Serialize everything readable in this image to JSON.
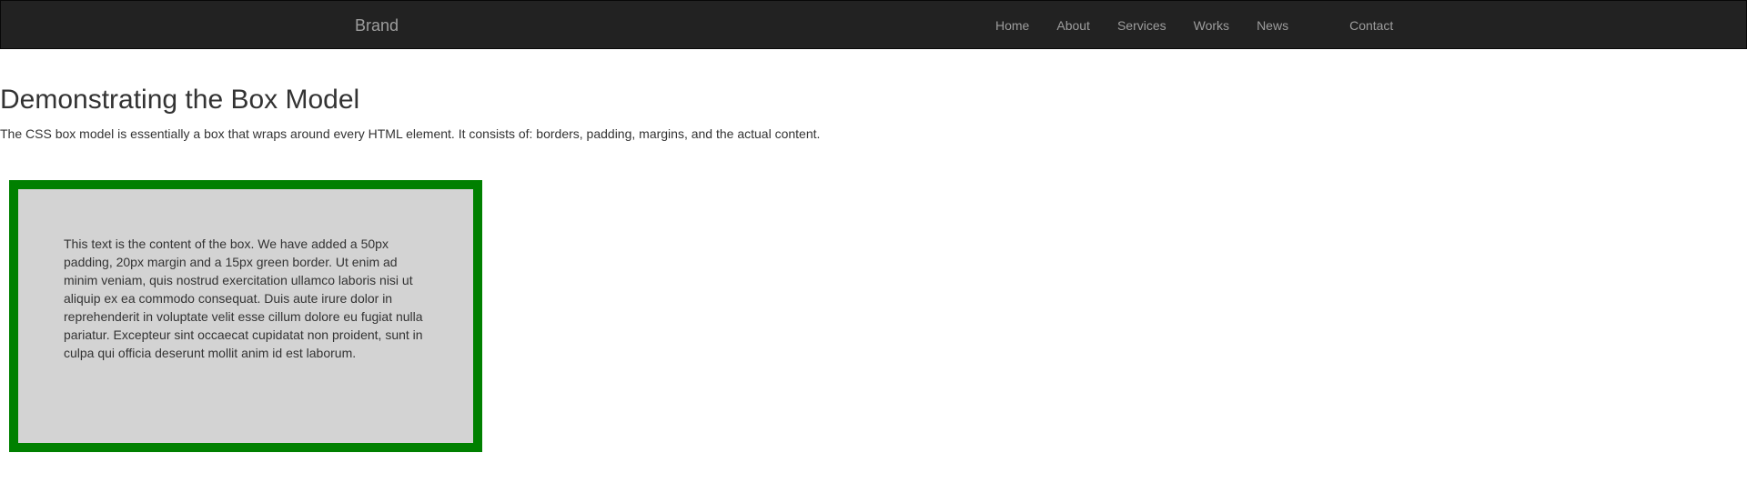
{
  "navbar": {
    "brand": "Brand",
    "items": [
      {
        "label": "Home"
      },
      {
        "label": "About"
      },
      {
        "label": "Services"
      },
      {
        "label": "Works"
      },
      {
        "label": "News"
      },
      {
        "label": "Contact"
      }
    ]
  },
  "main": {
    "title": "Demonstrating the Box Model",
    "intro": "The CSS box model is essentially a box that wraps around every HTML element. It consists of: borders, padding, margins, and the actual content.",
    "box_text": "This text is the content of the box. We have added a 50px padding, 20px margin and a 15px green border. Ut enim ad minim veniam, quis nostrud exercitation ullamco laboris nisi ut aliquip ex ea commodo consequat. Duis aute irure dolor in reprehenderit in voluptate velit esse cillum dolore eu fugiat nulla pariatur. Excepteur sint occaecat cupidatat non proident, sunt in culpa qui officia deserunt mollit anim id est laborum."
  },
  "colors": {
    "navbar_bg": "#222222",
    "nav_text": "#9d9d9d",
    "box_bg": "#d3d3d3",
    "box_border": "#008000"
  }
}
